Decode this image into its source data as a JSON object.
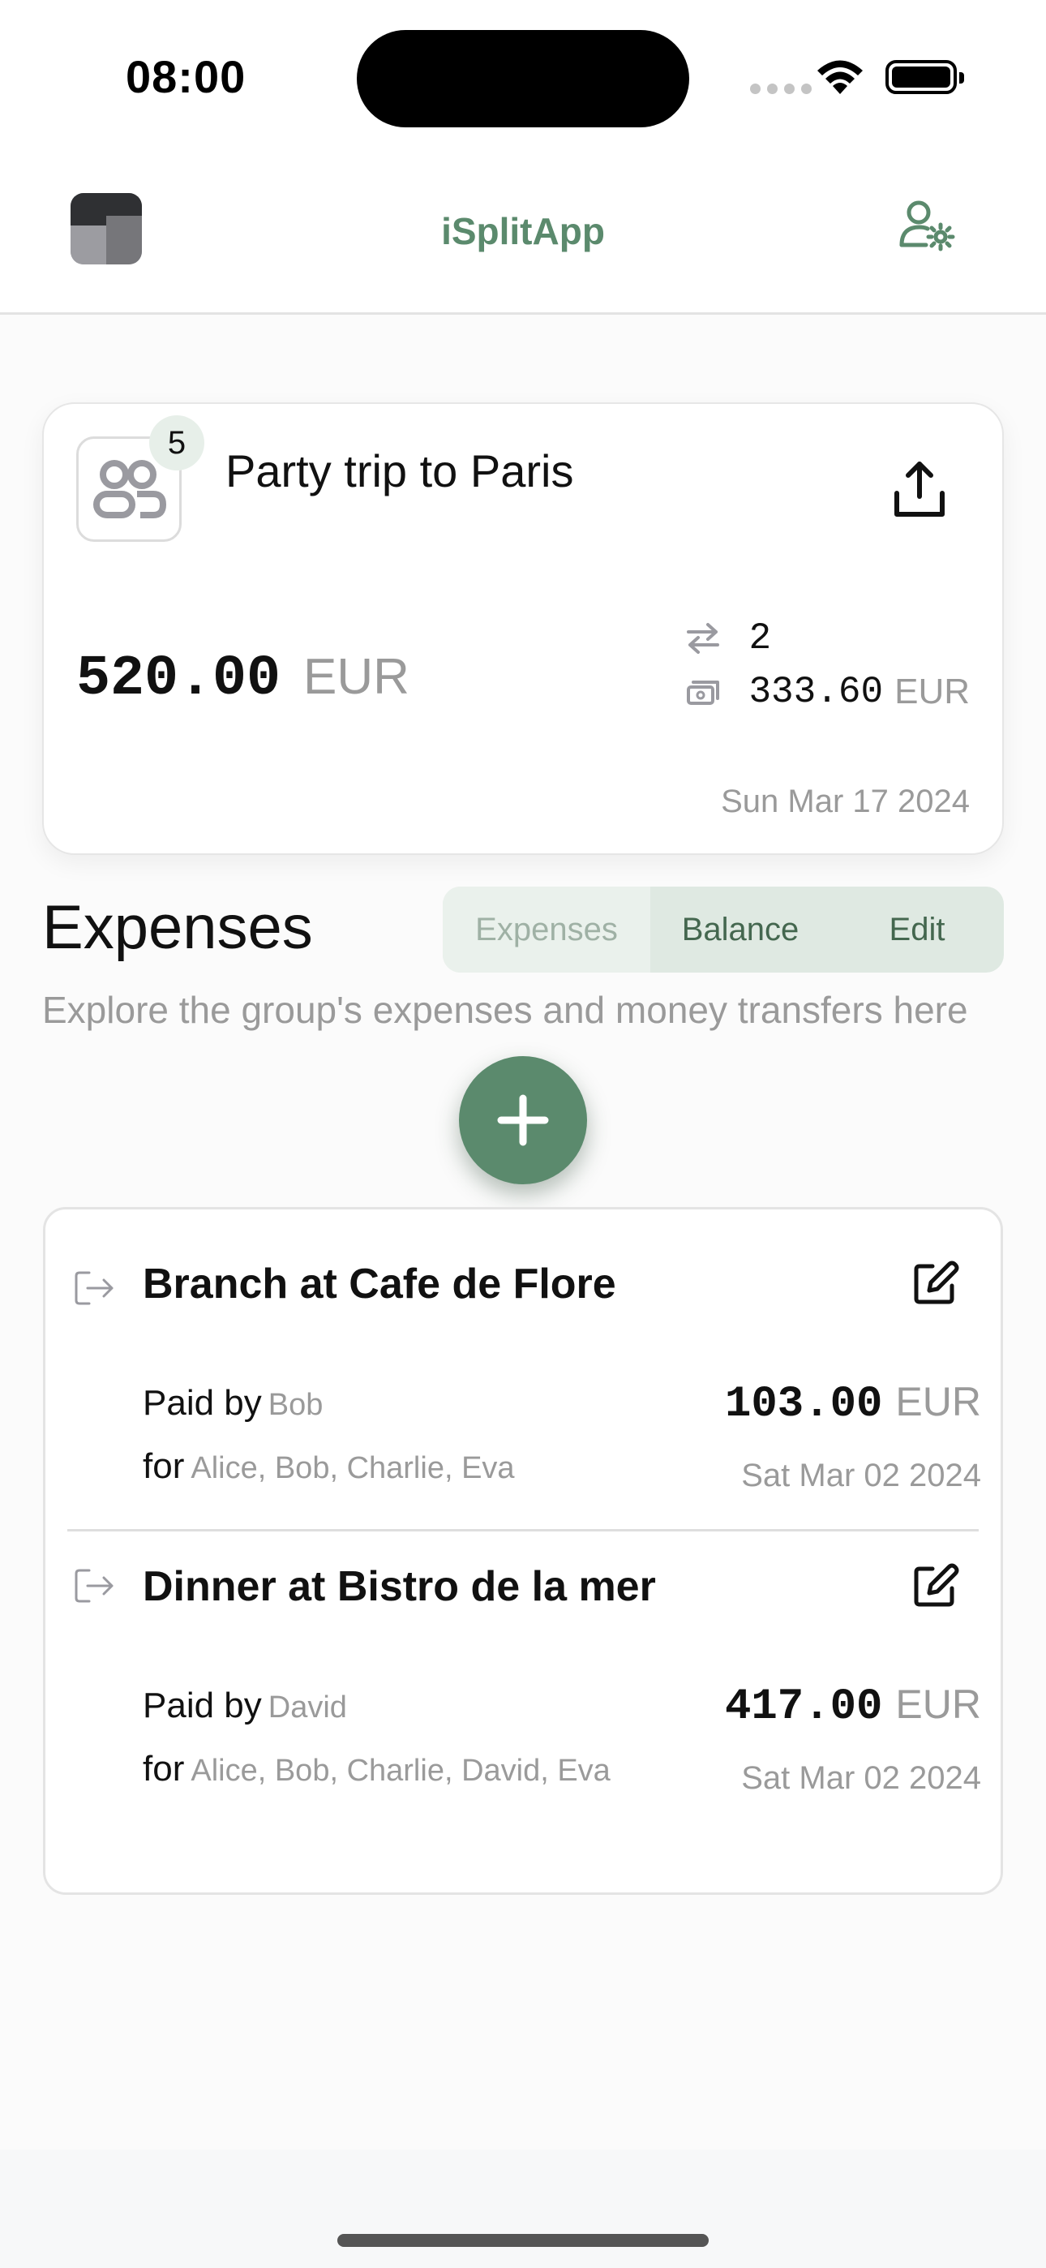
{
  "status_bar": {
    "time": "08:00"
  },
  "header": {
    "title": "iSplitApp"
  },
  "group": {
    "name": "Party trip to Paris",
    "member_count": "5",
    "total_amount": "520.00",
    "total_currency": "EUR",
    "transfers_count": "2",
    "my_share_amount": "333.60",
    "my_share_currency": "EUR",
    "date": "Sun Mar 17 2024"
  },
  "section": {
    "title": "Expenses",
    "subtitle": "Explore the group's expenses and money transfers here",
    "tabs": [
      "Expenses",
      "Balance",
      "Edit"
    ],
    "selected_tab": "Expenses"
  },
  "expenses": [
    {
      "title": "Branch at Cafe de Flore",
      "paid_by_label": "Paid by",
      "paid_by": "Bob",
      "for_label": "for",
      "for": "Alice, Bob, Charlie, Eva",
      "amount": "103.00",
      "currency": "EUR",
      "date": "Sat Mar 02 2024"
    },
    {
      "title": "Dinner at Bistro de la mer",
      "paid_by_label": "Paid by",
      "paid_by": "David",
      "for_label": "for",
      "for": "Alice, Bob, Charlie, David, Eva",
      "amount": "417.00",
      "currency": "EUR",
      "date": "Sat Mar 02 2024"
    }
  ],
  "icons": {
    "logo": "app-logo",
    "settings": "user-settings-icon",
    "group": "users-icon",
    "share": "share-upload-icon",
    "transfers": "arrows-swap-icon",
    "share_amount": "money-icon",
    "add": "plus-icon",
    "expense": "arrow-right-from-bracket-icon",
    "edit": "edit-icon"
  },
  "colors": {
    "accent": "#5b8a6d",
    "badge_bg": "#e7efe9",
    "segmented_bg": "#dfe9e2",
    "muted_text": "#9a9a9a"
  }
}
